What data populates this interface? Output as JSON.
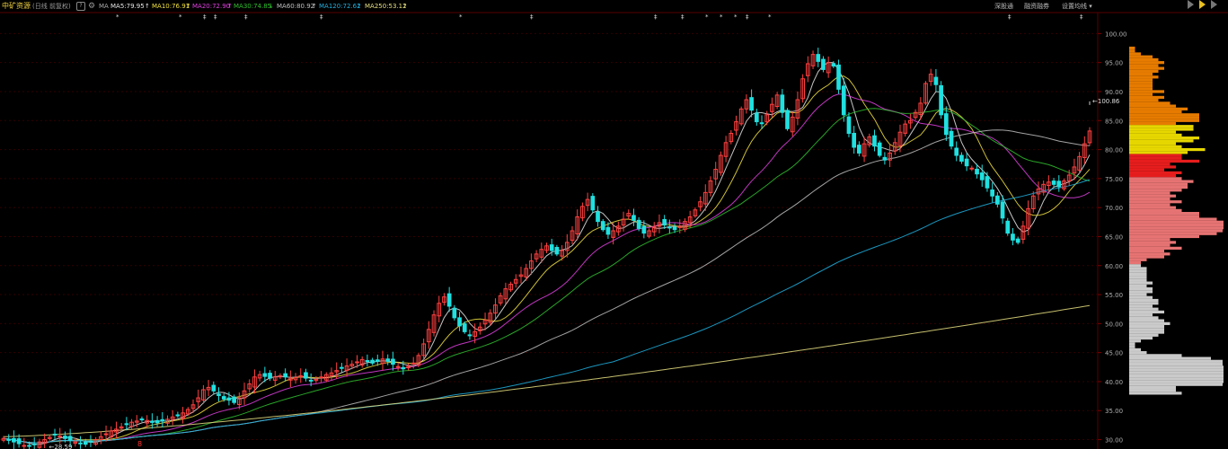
{
  "header": {
    "stock_name": "中矿资源",
    "mode": "(日线 前复权)",
    "help_icon": "?",
    "gear_icon": "gear-icon",
    "ma_label": "MA",
    "ma_items": [
      {
        "text": "MA5:79.95",
        "arrow": "↑",
        "color": "#e8e8e8"
      },
      {
        "text": "MA10:76.91",
        "arrow": "↑",
        "color": "#f0e040"
      },
      {
        "text": "MA20:72.90",
        "arrow": "↑",
        "color": "#e040e0"
      },
      {
        "text": "MA30:74.85",
        "arrow": "↓",
        "color": "#30c030"
      },
      {
        "text": "MA60:80.92",
        "arrow": "↑",
        "color": "#c0c0c0"
      },
      {
        "text": "MA120:72.62",
        "arrow": "↑",
        "color": "#20b0e0"
      },
      {
        "text": "MA250:53.12",
        "arrow": "↑",
        "color": "#e8e080"
      }
    ],
    "right_buttons": [
      "深股通",
      "融资融券",
      "设置均线 ▾"
    ]
  },
  "colors": {
    "up": "#ff4040",
    "down": "#20e0e0",
    "grid": "#330000",
    "axis_text": "#b0b0b0"
  },
  "chart_data": {
    "type": "candlestick",
    "ylim": [
      29,
      103
    ],
    "yticks": [
      "100.00",
      "95.00",
      "90.00",
      "85.00",
      "80.00",
      "75.00",
      "70.00",
      "65.00",
      "60.00",
      "55.00",
      "50.00",
      "45.00",
      "40.00",
      "35.00",
      "30.00"
    ],
    "annotations": {
      "high": "100.86",
      "low": "28.59"
    },
    "marker_text": "8",
    "close": [
      30.2,
      30.0,
      29.6,
      29.3,
      29.0,
      28.9,
      29.2,
      29.6,
      30.0,
      30.4,
      30.8,
      30.6,
      30.2,
      29.9,
      29.6,
      29.4,
      29.2,
      29.6,
      30.0,
      30.5,
      31.0,
      31.5,
      31.8,
      32.2,
      32.6,
      33.0,
      33.2,
      33.4,
      33.3,
      33.1,
      32.9,
      33.2,
      33.5,
      33.9,
      34.2,
      34.6,
      35.2,
      36.0,
      37.2,
      38.6,
      39.0,
      38.4,
      37.6,
      37.0,
      36.8,
      36.4,
      37.2,
      38.4,
      39.6,
      40.8,
      41.2,
      40.9,
      40.6,
      40.8,
      41.0,
      40.8,
      40.5,
      40.7,
      41.0,
      40.6,
      40.2,
      40.4,
      40.8,
      41.2,
      41.5,
      41.9,
      42.3,
      42.7,
      43.0,
      43.4,
      43.8,
      43.5,
      43.2,
      43.5,
      43.9,
      43.5,
      43.0,
      42.6,
      42.2,
      42.6,
      43.2,
      44.5,
      46.5,
      49.0,
      51.5,
      53.5,
      54.6,
      53.0,
      51.0,
      49.6,
      48.6,
      48.0,
      48.6,
      49.4,
      50.6,
      51.8,
      53.2,
      54.8,
      56.0,
      56.8,
      57.6,
      58.4,
      59.5,
      60.8,
      62.0,
      62.8,
      63.4,
      62.6,
      62.0,
      62.6,
      64.0,
      66.0,
      68.4,
      70.2,
      71.4,
      69.6,
      67.6,
      66.2,
      65.4,
      66.0,
      66.8,
      68.0,
      69.0,
      67.8,
      66.4,
      65.6,
      66.0,
      66.6,
      67.4,
      67.0,
      66.6,
      66.2,
      66.8,
      67.6,
      68.4,
      69.6,
      71.0,
      72.6,
      74.6,
      76.6,
      79.0,
      81.2,
      82.8,
      84.8,
      87.0,
      88.6,
      86.8,
      84.8,
      84.6,
      86.0,
      87.8,
      89.4,
      86.4,
      83.6,
      85.6,
      88.6,
      92.2,
      94.8,
      96.4,
      95.2,
      93.8,
      95.0,
      94.4,
      90.4,
      86.0,
      82.8,
      80.4,
      79.4,
      81.0,
      82.2,
      80.6,
      79.0,
      78.2,
      79.4,
      81.2,
      83.0,
      84.4,
      85.0,
      86.4,
      88.0,
      91.4,
      93.0,
      91.2,
      86.0,
      82.6,
      80.6,
      79.0,
      78.0,
      77.2,
      76.8,
      75.8,
      74.8,
      73.4,
      72.0,
      70.6,
      68.2,
      65.6,
      64.4,
      64.0,
      66.8,
      69.8,
      72.0,
      73.2,
      74.0,
      74.4,
      74.0,
      73.6,
      74.6,
      75.6,
      77.0,
      78.8,
      81.0,
      83.2
    ]
  }
}
